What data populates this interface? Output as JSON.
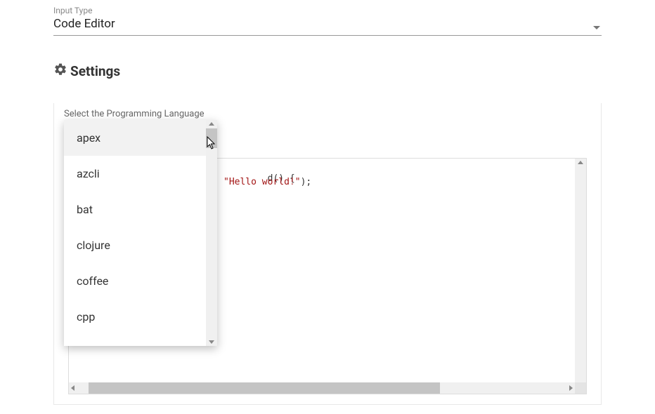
{
  "input_type": {
    "label": "Input Type",
    "value": "Code Editor"
  },
  "settings": {
    "title": "Settings"
  },
  "language_select": {
    "label": "Select the Programming Language",
    "options": [
      "apex",
      "azcli",
      "bat",
      "clojure",
      "coffee",
      "cpp"
    ],
    "highlighted_index": 0
  },
  "code": {
    "line1_visible": "d() {",
    "line2_prefix": "",
    "line2_string": "\"Hello world!\"",
    "line2_suffix": ");"
  }
}
